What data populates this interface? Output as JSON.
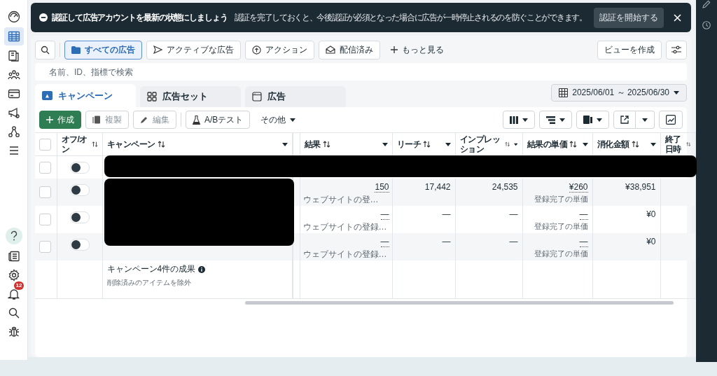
{
  "sidebar": {
    "top_items": [
      {
        "selected": false
      },
      {
        "selected": true
      },
      {
        "selected": false
      },
      {
        "selected": false
      },
      {
        "selected": false
      },
      {
        "selected": false
      },
      {
        "selected": false
      },
      {
        "selected": false
      }
    ],
    "bottom_items": [
      {
        "kind": "help"
      },
      {
        "kind": "news"
      },
      {
        "kind": "settings"
      },
      {
        "kind": "bell",
        "badge": "12"
      },
      {
        "kind": "search"
      },
      {
        "kind": "bug"
      }
    ]
  },
  "banner": {
    "title": "認証して広告アカウントを最新の状態にしましょう",
    "message": "認証を完了しておくと、今後認証が必須となった場合に広告が一時停止されるのを防ぐことができます。",
    "button": "認証を開始する"
  },
  "filters": [
    {
      "label": "すべての広告",
      "selected": true
    },
    {
      "label": "アクティブな広告",
      "selected": false
    },
    {
      "label": "アクション",
      "selected": false
    },
    {
      "label": "配信済み",
      "selected": false
    }
  ],
  "more_filters": "もっと見る",
  "create_view": "ビューを作成",
  "search": {
    "placeholder": "名前、ID、指標で検索"
  },
  "tabs": [
    {
      "label": "キャンペーン",
      "selected": true
    },
    {
      "label": "広告セット",
      "selected": false
    },
    {
      "label": "広告",
      "selected": false
    }
  ],
  "date_range": "2025/06/01 ～ 2025/06/30",
  "toolbar": [
    {
      "kind": "create",
      "label": "作成",
      "disabled": false
    },
    {
      "kind": "duplicate",
      "label": "複製",
      "disabled": true
    },
    {
      "kind": "edit",
      "label": "編集",
      "disabled": true
    },
    {
      "kind": "abtest",
      "label": "A/Bテスト",
      "disabled": false
    },
    {
      "kind": "more",
      "label": "その他",
      "disabled": false
    }
  ],
  "table": {
    "columns": [
      {
        "label": "オフ/オン",
        "dropdown": false
      },
      {
        "label": "キャンペーン",
        "dropdown": true
      },
      {
        "label": "結果",
        "dropdown": true
      },
      {
        "label": "リーチ",
        "dropdown": true
      },
      {
        "label": "インプレッション",
        "dropdown": true
      },
      {
        "label": "結果の単価",
        "dropdown": true
      },
      {
        "label": "消化金額",
        "dropdown": true
      },
      {
        "label": "終了日時",
        "dropdown": false
      }
    ],
    "select_all_checked": false,
    "rows": [
      {
        "checked": false,
        "on": false
      },
      {
        "checked": false,
        "on": false,
        "result": "150",
        "result_sub": "ウェブサイトの登…",
        "reach": "17,442",
        "impressions": "24,535",
        "cost": "¥260",
        "cost_sub": "登録完了の単価",
        "spend": "¥38,951"
      },
      {
        "checked": false,
        "on": false,
        "result": "—",
        "result_sub": "ウェブサイトの登録…",
        "reach": "—",
        "impressions": "—",
        "cost": "—",
        "cost_sub": "登録完了の単価",
        "spend": "¥0"
      },
      {
        "checked": false,
        "on": false,
        "result": "—",
        "result_sub": "ウェブサイトの登録…",
        "reach": "—",
        "impressions": "—",
        "cost": "—",
        "cost_sub": "登録完了の単価",
        "spend": "¥0"
      }
    ],
    "summary": {
      "title": "キャンペーン4件の成果",
      "note": "削除済みのアイテムを除外"
    }
  }
}
